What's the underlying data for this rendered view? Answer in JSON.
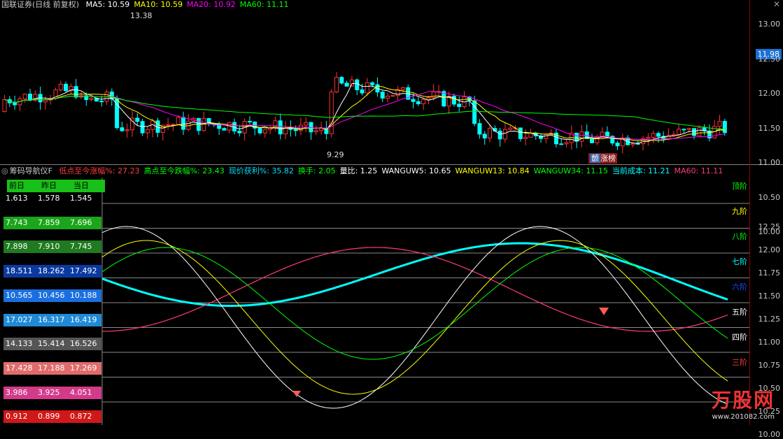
{
  "top_panel": {
    "title": "国联证券(日线 前复权)",
    "indicators": [
      {
        "label": "MA5: 10.59",
        "color": "#ffffff"
      },
      {
        "label": "MA10: 10.59",
        "color": "#ffff00"
      },
      {
        "label": "MA20: 10.92",
        "color": "#ff00ff"
      },
      {
        "label": "MA60: 11.11",
        "color": "#00ff00"
      }
    ],
    "high_mark": "13.38",
    "low_mark": "9.29",
    "current_price": "11.98",
    "zhangting_label": "涨榜",
    "zhangting_prefix": "颤",
    "y_axis": [
      "13.00",
      "12.50",
      "12.00",
      "11.50",
      "11.00",
      "10.50",
      "10.00"
    ]
  },
  "bottom_panel": {
    "title": "筹码导航仪F",
    "indicators": [
      {
        "label": "低点至今涨幅%: 27.23",
        "color": "#ff3b3b"
      },
      {
        "label": "高点至今跌幅%: 23.43",
        "color": "#00ff00"
      },
      {
        "label": "现价获利%: 35.82",
        "color": "#00e0ff"
      },
      {
        "label": "换手: 2.05",
        "color": "#00ff00"
      },
      {
        "label": "量比: 1.25",
        "color": "#ffffff"
      },
      {
        "label": "WANGUW5: 10.65",
        "color": "#ffffff"
      },
      {
        "label": "WANGUW13: 10.84",
        "color": "#ffff00"
      },
      {
        "label": "WANGUW34: 11.15",
        "color": "#00ff00"
      },
      {
        "label": "当前成本: 11.21",
        "color": "#00ffff"
      },
      {
        "label": "MA60: 11.11",
        "color": "#ff3b7b"
      }
    ],
    "table_headers": [
      "前日",
      "昨日",
      "当日"
    ],
    "table_rows": [
      {
        "values": [
          "1.613",
          "1.578",
          "1.545"
        ],
        "color": "#000000"
      },
      {
        "values": [
          "7.743",
          "7.859",
          "7.696"
        ],
        "color": "#1aa51a"
      },
      {
        "values": [
          "7.898",
          "7.910",
          "7.745"
        ],
        "color": "#207a20"
      },
      {
        "values": [
          "18.511",
          "18.262",
          "17.492"
        ],
        "color": "#0a3aa0"
      },
      {
        "values": [
          "10.565",
          "10.456",
          "10.188"
        ],
        "color": "#1a6fe0"
      },
      {
        "values": [
          "17.027",
          "16.317",
          "16.419"
        ],
        "color": "#1f8ad6"
      },
      {
        "values": [
          "14.133",
          "15.414",
          "16.526"
        ],
        "color": "#555555"
      },
      {
        "values": [
          "17.428",
          "17.188",
          "17.269"
        ],
        "color": "#e06b6b"
      },
      {
        "values": [
          "3.986",
          "3.925",
          "4.051"
        ],
        "color": "#d33a8a"
      },
      {
        "values": [
          "0.912",
          "0.899",
          "0.872"
        ],
        "color": "#d01818"
      }
    ],
    "tiers": [
      {
        "label": "顶阶",
        "color": "#00ff00"
      },
      {
        "label": "九阶",
        "color": "#ffff00"
      },
      {
        "label": "八阶",
        "color": "#00ff00"
      },
      {
        "label": "七阶",
        "color": "#00ffff"
      },
      {
        "label": "六阶",
        "color": "#1a4dff"
      },
      {
        "label": "五阶",
        "color": "#ffffff"
      },
      {
        "label": "四阶",
        "color": "#ffffff"
      },
      {
        "label": "三阶",
        "color": "#ff3b3b"
      }
    ],
    "y_axis": [
      "12.25",
      "12.00",
      "11.75",
      "11.50",
      "11.25",
      "11.00",
      "10.75",
      "10.50",
      "10.25",
      "10.00"
    ]
  },
  "watermark": {
    "brand": "万股网",
    "url": "www.201082.com"
  }
}
